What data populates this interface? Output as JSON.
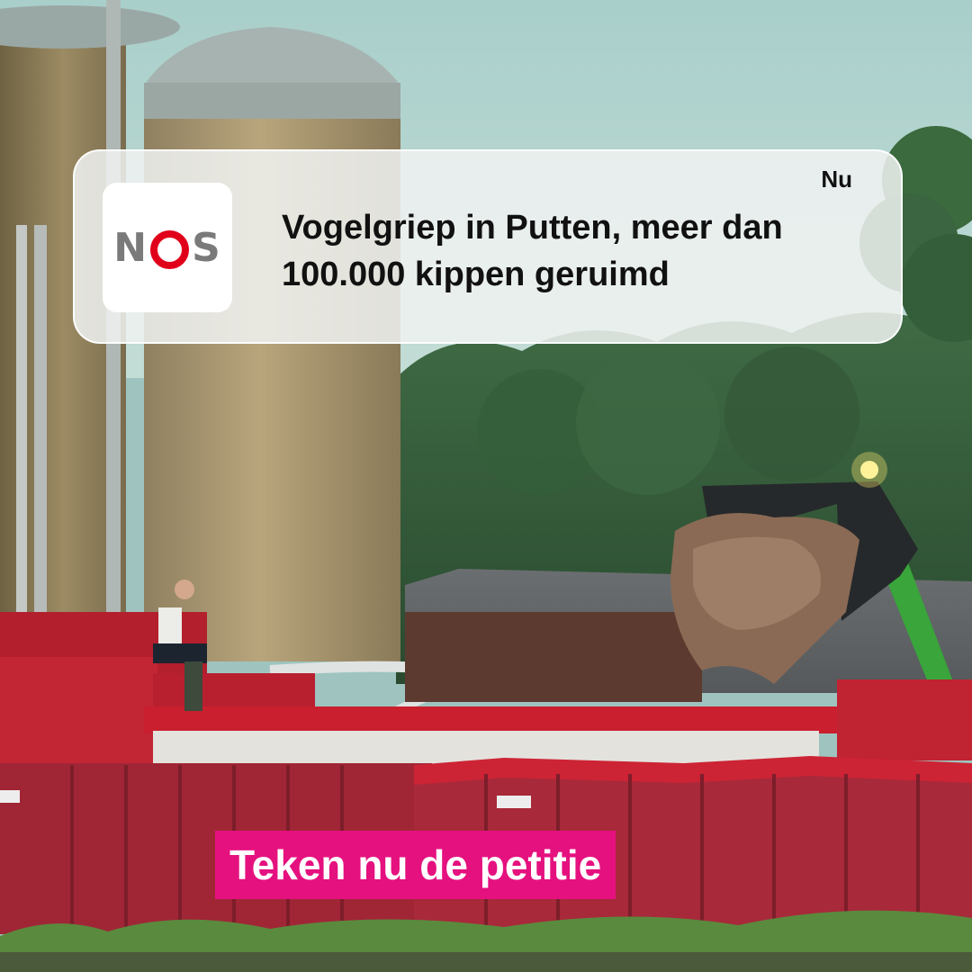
{
  "notification": {
    "app_name": "NOS",
    "time": "Nu",
    "title": "Vogelgriep in Putten, meer dan 100.000 kippen geruimd"
  },
  "cta": {
    "label": "Teken nu de petitie",
    "color": "#e5117f"
  },
  "brand": {
    "nos_red": "#e1001a",
    "nos_grey": "#7a7a7a"
  }
}
